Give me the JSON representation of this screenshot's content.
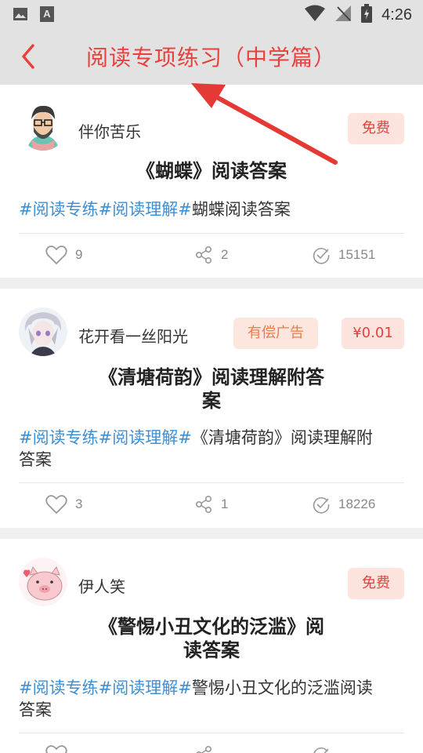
{
  "status_bar": {
    "time": "4:26"
  },
  "header": {
    "title": "阅读专项练习（中学篇）"
  },
  "posts": [
    {
      "author": "伴你苦乐",
      "badges": [
        "免费"
      ],
      "title": "《蝴蝶》阅读答案",
      "tags": [
        "#阅读专练",
        "#阅读理解",
        "#"
      ],
      "desc_text": "蝴蝶阅读答案",
      "likes": "9",
      "shares": "2",
      "views": "15151"
    },
    {
      "author": "花开看一丝阳光",
      "badges": [
        "有偿广告",
        "¥0.01"
      ],
      "title_line1": "《清塘荷韵》阅读理解附答",
      "title_line2": "案",
      "tags": [
        "#阅读专练",
        "#阅读理解",
        "#"
      ],
      "desc_line1": "《清塘荷韵》阅读理解附",
      "desc_line2": "答案",
      "likes": "3",
      "shares": "1",
      "views": "18226"
    },
    {
      "author": "伊人笑",
      "badges": [
        "免费"
      ],
      "title_line1": "《警惕小丑文化的泛滥》阅",
      "title_line2": "读答案",
      "tags": [
        "#阅读专练",
        "#阅读理解",
        "#"
      ],
      "desc_line1": "警惕小丑文化的泛滥阅读",
      "desc_line2": "答案"
    }
  ],
  "colors": {
    "accent": "#e8413d",
    "link": "#3d8fd6",
    "ad": "#f07a4a"
  }
}
